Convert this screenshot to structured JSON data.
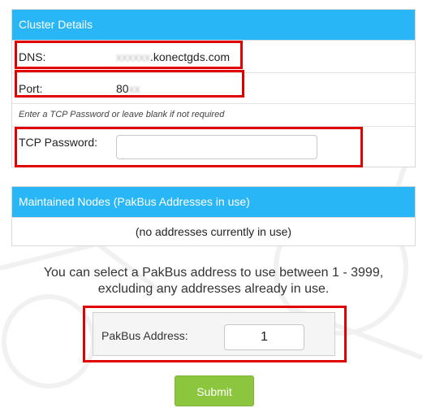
{
  "cluster": {
    "header": "Cluster Details",
    "dns_label": "DNS:",
    "dns_obscured": "xxxxxx",
    "dns_value": ".konectgds.com",
    "port_label": "Port:",
    "port_value": "80",
    "port_obscured": "xx",
    "hint": "Enter a TCP Password or leave blank if not required",
    "password_label": "TCP Password:",
    "password_value": ""
  },
  "nodes": {
    "header": "Maintained Nodes (PakBus Addresses in use)",
    "empty_text": "(no addresses currently in use)"
  },
  "pakbus": {
    "info_line1": "You can select a PakBus address to use between 1 - 3999,",
    "info_line2": "excluding any addresses already in use.",
    "address_label": "PakBus Address:",
    "address_value": "1"
  },
  "submit_label": "Submit",
  "colors": {
    "header_bg": "#29b6f6",
    "highlight": "#e00000",
    "submit_bg": "#8cc63f"
  }
}
